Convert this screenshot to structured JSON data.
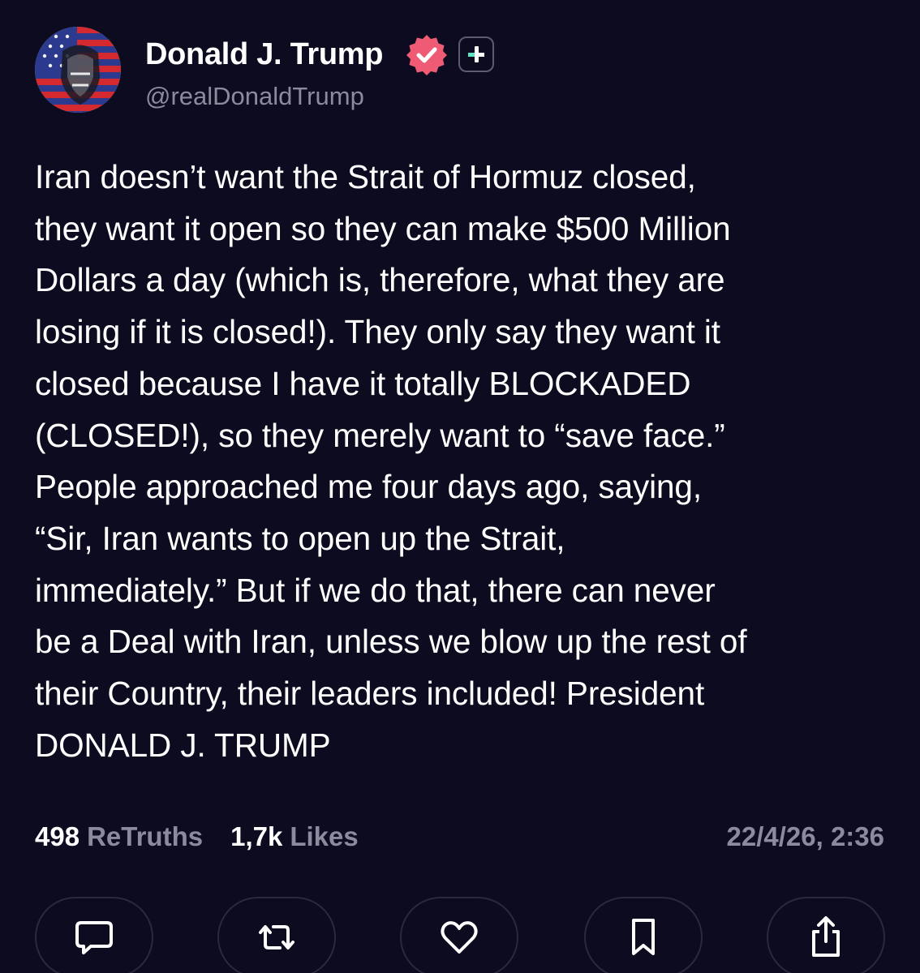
{
  "account": {
    "display_name": "Donald J. Trump",
    "handle": "@realDonaldTrump",
    "verified": true,
    "avatar": "avatar-flag-portrait-icon"
  },
  "post": {
    "text": "Iran doesn’t want the Strait of Hormuz closed,\nthey want it open so they can make $500 Million\nDollars a day (which is, therefore, what they are\nlosing if it is closed!). They only say they want it\nclosed because I have it totally BLOCKADED\n(CLOSED!), so they merely want to “save face.”\nPeople approached me four days ago, saying,\n“Sir, Iran wants to open up the Strait,\nimmediately.” But if we do that, there can never\nbe a Deal with Iran, unless we blow up the rest of\ntheir Country, their leaders included! President\nDONALD J. TRUMP"
  },
  "stats": {
    "retruths_count": "498",
    "retruths_label": "ReTruths",
    "likes_count": "1,7k",
    "likes_label": "Likes",
    "timestamp": "22/4/26, 2:36"
  },
  "actions": [
    "reply-icon",
    "retruth-icon",
    "like-icon",
    "bookmark-icon",
    "share-icon"
  ],
  "colors": {
    "background": "#0c0b1f",
    "text": "#ffffff",
    "muted": "#8c8b9e",
    "verified_badge": "#ef5a74",
    "follow_plus_accent": "#5ee3c5",
    "button_border": "#2a2940"
  }
}
